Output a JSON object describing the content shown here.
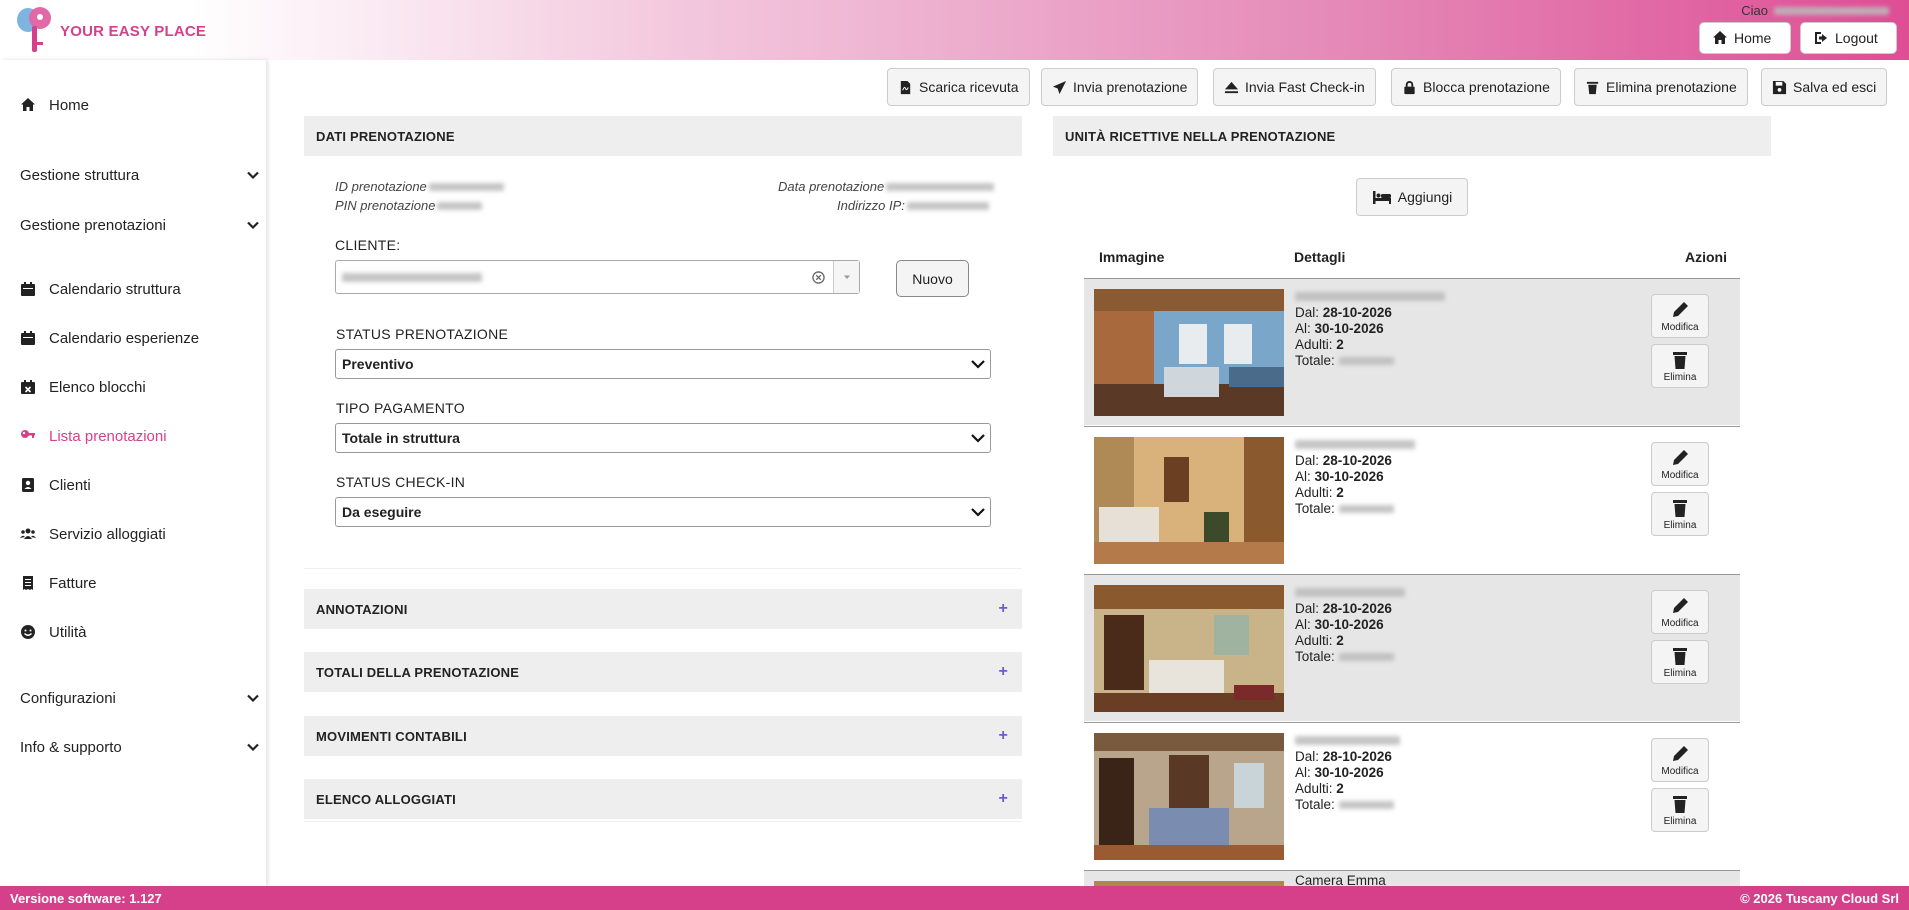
{
  "header": {
    "logo_text": "YOUR EASY PLACE",
    "greeting": "Ciao",
    "home_label": "Home",
    "logout_label": "Logout"
  },
  "sidebar": {
    "items": [
      {
        "label": "Home",
        "icon": "home-icon"
      },
      {
        "label": "Gestione struttura",
        "group": true
      },
      {
        "label": "Gestione prenotazioni",
        "group": true
      },
      {
        "label": "Calendario struttura",
        "icon": "calendar-icon"
      },
      {
        "label": "Calendario esperienze",
        "icon": "calendar-icon"
      },
      {
        "label": "Elenco blocchi",
        "icon": "calendar-x-icon"
      },
      {
        "label": "Lista prenotazioni",
        "icon": "key-icon",
        "active": true
      },
      {
        "label": "Clienti",
        "icon": "contact-book-icon"
      },
      {
        "label": "Servizio alloggiati",
        "icon": "users-icon"
      },
      {
        "label": "Fatture",
        "icon": "receipt-icon"
      },
      {
        "label": "Utilità",
        "icon": "smile-icon"
      },
      {
        "label": "Configurazioni",
        "group": true
      },
      {
        "label": "Info & supporto",
        "group": true
      }
    ]
  },
  "toolbar": {
    "scarica": "Scarica ricevuta",
    "invia": "Invia prenotazione",
    "fast": "Invia Fast Check-in",
    "blocca": "Blocca prenotazione",
    "elimina": "Elimina prenotazione",
    "salva": "Salva ed esci"
  },
  "dati": {
    "title": "DATI PRENOTAZIONE",
    "id_label": "ID prenotazione",
    "pin_label": "PIN prenotazione",
    "data_label": "Data prenotazione",
    "ip_label": "Indirizzo IP:",
    "cliente_label": "CLIENTE:",
    "nuovo_label": "Nuovo",
    "status_label": "STATUS PRENOTAZIONE",
    "status_value": "Preventivo",
    "tipo_label": "TIPO PAGAMENTO",
    "tipo_value": "Totale in struttura",
    "checkin_label": "STATUS CHECK-IN",
    "checkin_value": "Da eseguire"
  },
  "sections": [
    {
      "title": "ANNOTAZIONI"
    },
    {
      "title": "TOTALI DELLA PRENOTAZIONE"
    },
    {
      "title": "MOVIMENTI CONTABILI"
    },
    {
      "title": "ELENCO ALLOGGIATI"
    }
  ],
  "units": {
    "title": "UNITÀ RICETTIVE NELLA PRENOTAZIONE",
    "add_label": "Aggiungi",
    "columns": [
      "Immagine",
      "Dettagli",
      "Azioni"
    ],
    "edit_label": "Modifica",
    "delete_label": "Elimina",
    "rows": [
      {
        "dal": "28-10-2026",
        "al": "30-10-2026",
        "adulti": "2"
      },
      {
        "dal": "28-10-2026",
        "al": "30-10-2026",
        "adulti": "2"
      },
      {
        "dal": "28-10-2026",
        "al": "30-10-2026",
        "adulti": "2"
      },
      {
        "dal": "28-10-2026",
        "al": "30-10-2026",
        "adulti": "2"
      }
    ],
    "partial_row_name": "Camera Emma",
    "labels": {
      "dal": "Dal:",
      "al": "Al:",
      "adulti": "Adulti:",
      "totale": "Totale:"
    }
  },
  "footer": {
    "version_label": "Versione software:",
    "version": "1.127",
    "copyright": "© 2026 Tuscany Cloud Srl"
  },
  "colors": {
    "brand": "#d6408b",
    "accent": "#6b5cc7"
  }
}
